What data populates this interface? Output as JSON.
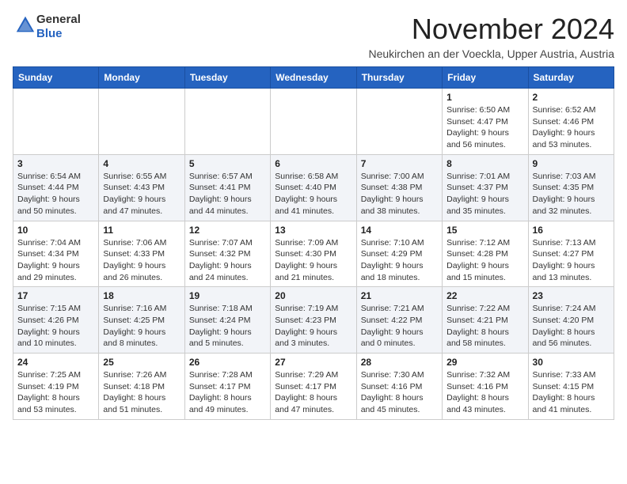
{
  "header": {
    "logo_line1": "General",
    "logo_line2": "Blue",
    "month_title": "November 2024",
    "location": "Neukirchen an der Voeckla, Upper Austria, Austria"
  },
  "weekdays": [
    "Sunday",
    "Monday",
    "Tuesday",
    "Wednesday",
    "Thursday",
    "Friday",
    "Saturday"
  ],
  "weeks": [
    [
      {
        "day": "",
        "info": ""
      },
      {
        "day": "",
        "info": ""
      },
      {
        "day": "",
        "info": ""
      },
      {
        "day": "",
        "info": ""
      },
      {
        "day": "",
        "info": ""
      },
      {
        "day": "1",
        "info": "Sunrise: 6:50 AM\nSunset: 4:47 PM\nDaylight: 9 hours and 56 minutes."
      },
      {
        "day": "2",
        "info": "Sunrise: 6:52 AM\nSunset: 4:46 PM\nDaylight: 9 hours and 53 minutes."
      }
    ],
    [
      {
        "day": "3",
        "info": "Sunrise: 6:54 AM\nSunset: 4:44 PM\nDaylight: 9 hours and 50 minutes."
      },
      {
        "day": "4",
        "info": "Sunrise: 6:55 AM\nSunset: 4:43 PM\nDaylight: 9 hours and 47 minutes."
      },
      {
        "day": "5",
        "info": "Sunrise: 6:57 AM\nSunset: 4:41 PM\nDaylight: 9 hours and 44 minutes."
      },
      {
        "day": "6",
        "info": "Sunrise: 6:58 AM\nSunset: 4:40 PM\nDaylight: 9 hours and 41 minutes."
      },
      {
        "day": "7",
        "info": "Sunrise: 7:00 AM\nSunset: 4:38 PM\nDaylight: 9 hours and 38 minutes."
      },
      {
        "day": "8",
        "info": "Sunrise: 7:01 AM\nSunset: 4:37 PM\nDaylight: 9 hours and 35 minutes."
      },
      {
        "day": "9",
        "info": "Sunrise: 7:03 AM\nSunset: 4:35 PM\nDaylight: 9 hours and 32 minutes."
      }
    ],
    [
      {
        "day": "10",
        "info": "Sunrise: 7:04 AM\nSunset: 4:34 PM\nDaylight: 9 hours and 29 minutes."
      },
      {
        "day": "11",
        "info": "Sunrise: 7:06 AM\nSunset: 4:33 PM\nDaylight: 9 hours and 26 minutes."
      },
      {
        "day": "12",
        "info": "Sunrise: 7:07 AM\nSunset: 4:32 PM\nDaylight: 9 hours and 24 minutes."
      },
      {
        "day": "13",
        "info": "Sunrise: 7:09 AM\nSunset: 4:30 PM\nDaylight: 9 hours and 21 minutes."
      },
      {
        "day": "14",
        "info": "Sunrise: 7:10 AM\nSunset: 4:29 PM\nDaylight: 9 hours and 18 minutes."
      },
      {
        "day": "15",
        "info": "Sunrise: 7:12 AM\nSunset: 4:28 PM\nDaylight: 9 hours and 15 minutes."
      },
      {
        "day": "16",
        "info": "Sunrise: 7:13 AM\nSunset: 4:27 PM\nDaylight: 9 hours and 13 minutes."
      }
    ],
    [
      {
        "day": "17",
        "info": "Sunrise: 7:15 AM\nSunset: 4:26 PM\nDaylight: 9 hours and 10 minutes."
      },
      {
        "day": "18",
        "info": "Sunrise: 7:16 AM\nSunset: 4:25 PM\nDaylight: 9 hours and 8 minutes."
      },
      {
        "day": "19",
        "info": "Sunrise: 7:18 AM\nSunset: 4:24 PM\nDaylight: 9 hours and 5 minutes."
      },
      {
        "day": "20",
        "info": "Sunrise: 7:19 AM\nSunset: 4:23 PM\nDaylight: 9 hours and 3 minutes."
      },
      {
        "day": "21",
        "info": "Sunrise: 7:21 AM\nSunset: 4:22 PM\nDaylight: 9 hours and 0 minutes."
      },
      {
        "day": "22",
        "info": "Sunrise: 7:22 AM\nSunset: 4:21 PM\nDaylight: 8 hours and 58 minutes."
      },
      {
        "day": "23",
        "info": "Sunrise: 7:24 AM\nSunset: 4:20 PM\nDaylight: 8 hours and 56 minutes."
      }
    ],
    [
      {
        "day": "24",
        "info": "Sunrise: 7:25 AM\nSunset: 4:19 PM\nDaylight: 8 hours and 53 minutes."
      },
      {
        "day": "25",
        "info": "Sunrise: 7:26 AM\nSunset: 4:18 PM\nDaylight: 8 hours and 51 minutes."
      },
      {
        "day": "26",
        "info": "Sunrise: 7:28 AM\nSunset: 4:17 PM\nDaylight: 8 hours and 49 minutes."
      },
      {
        "day": "27",
        "info": "Sunrise: 7:29 AM\nSunset: 4:17 PM\nDaylight: 8 hours and 47 minutes."
      },
      {
        "day": "28",
        "info": "Sunrise: 7:30 AM\nSunset: 4:16 PM\nDaylight: 8 hours and 45 minutes."
      },
      {
        "day": "29",
        "info": "Sunrise: 7:32 AM\nSunset: 4:16 PM\nDaylight: 8 hours and 43 minutes."
      },
      {
        "day": "30",
        "info": "Sunrise: 7:33 AM\nSunset: 4:15 PM\nDaylight: 8 hours and 41 minutes."
      }
    ]
  ]
}
